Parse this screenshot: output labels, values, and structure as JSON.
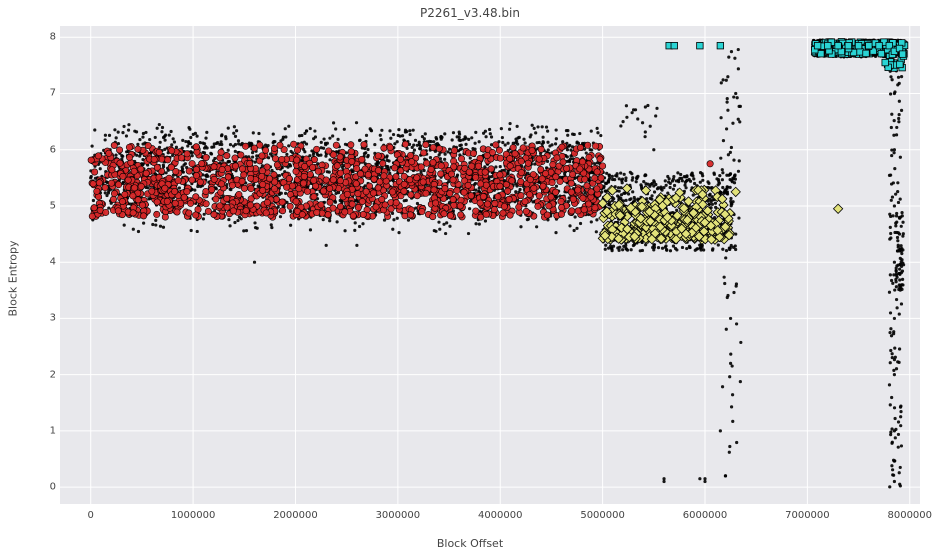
{
  "chart_data": {
    "type": "scatter",
    "title": "P2261_v3.48.bin",
    "xlabel": "Block Offset",
    "ylabel": "Block Entropy",
    "xlim": [
      -300000,
      8100000
    ],
    "ylim": [
      -0.3,
      8.2
    ],
    "xticks": [
      0,
      1000000,
      2000000,
      3000000,
      4000000,
      5000000,
      6000000,
      7000000,
      8000000
    ],
    "yticks": [
      0,
      1,
      2,
      3,
      4,
      5,
      6,
      7,
      8
    ],
    "grid": true,
    "legend": false,
    "series": [
      {
        "name": "black-dots",
        "marker": "circle",
        "size": 3,
        "fill": "#000000",
        "stroke": "#000000",
        "note": "Dense scatter of per-block entropy (raw). Region 0–5,000,000: band ~4.5–6.2; region 5,000,000–6,300,000: band ~3.5–5.5 plus outliers down to ~0 and up to ~7.9; region 7,100,000–7,950,000: mostly near 7.8 with a vertical spread column near ~7,850,000 spanning 0–7.9.",
        "sample_points": [
          {
            "x": 0,
            "y": 5.5
          },
          {
            "x": 200000,
            "y": 5.8
          },
          {
            "x": 400000,
            "y": 5.6
          },
          {
            "x": 600000,
            "y": 5.4
          },
          {
            "x": 800000,
            "y": 5.9
          },
          {
            "x": 1000000,
            "y": 5.7
          },
          {
            "x": 1200000,
            "y": 5.3
          },
          {
            "x": 1400000,
            "y": 5.8
          },
          {
            "x": 1600000,
            "y": 5.6
          },
          {
            "x": 1800000,
            "y": 5.5
          },
          {
            "x": 2000000,
            "y": 5.9
          },
          {
            "x": 2200000,
            "y": 5.4
          },
          {
            "x": 2400000,
            "y": 5.7
          },
          {
            "x": 2600000,
            "y": 5.8
          },
          {
            "x": 2800000,
            "y": 5.5
          },
          {
            "x": 3000000,
            "y": 5.6
          },
          {
            "x": 3500000,
            "y": 5.5
          },
          {
            "x": 4000000,
            "y": 5.7
          },
          {
            "x": 4500000,
            "y": 5.6
          },
          {
            "x": 5000000,
            "y": 5.5
          },
          {
            "x": 1600000,
            "y": 4.0
          },
          {
            "x": 2300000,
            "y": 4.3
          },
          {
            "x": 2600000,
            "y": 4.3
          },
          {
            "x": 5200000,
            "y": 5.0
          },
          {
            "x": 5400000,
            "y": 4.8
          },
          {
            "x": 5600000,
            "y": 4.5
          },
          {
            "x": 5800000,
            "y": 4.9
          },
          {
            "x": 6000000,
            "y": 4.7
          },
          {
            "x": 6200000,
            "y": 5.0
          },
          {
            "x": 5200000,
            "y": 6.5
          },
          {
            "x": 5500000,
            "y": 6.0
          },
          {
            "x": 5600000,
            "y": 0.1
          },
          {
            "x": 6000000,
            "y": 0.1
          },
          {
            "x": 6150000,
            "y": 1.0
          },
          {
            "x": 6200000,
            "y": 0.2
          },
          {
            "x": 6250000,
            "y": 3.0
          },
          {
            "x": 6250000,
            "y": 2.2
          },
          {
            "x": 6300000,
            "y": 7.0
          },
          {
            "x": 6300000,
            "y": 4.5
          },
          {
            "x": 7100000,
            "y": 7.8
          },
          {
            "x": 7300000,
            "y": 7.8
          },
          {
            "x": 7500000,
            "y": 7.8
          },
          {
            "x": 7700000,
            "y": 7.8
          },
          {
            "x": 7800000,
            "y": 7.7
          },
          {
            "x": 7850000,
            "y": 7.0
          },
          {
            "x": 7850000,
            "y": 6.0
          },
          {
            "x": 7850000,
            "y": 5.0
          },
          {
            "x": 7850000,
            "y": 4.0
          },
          {
            "x": 7850000,
            "y": 3.0
          },
          {
            "x": 7850000,
            "y": 2.0
          },
          {
            "x": 7850000,
            "y": 1.0
          },
          {
            "x": 7850000,
            "y": 0.1
          },
          {
            "x": 7900000,
            "y": 4.2
          },
          {
            "x": 7900000,
            "y": 3.8
          },
          {
            "x": 7900000,
            "y": 4.5
          },
          {
            "x": 7920000,
            "y": 7.3
          },
          {
            "x": 7920000,
            "y": 6.7
          }
        ]
      },
      {
        "name": "red-circles",
        "marker": "circle",
        "size": 6,
        "fill": "#d62728",
        "stroke": "#000000",
        "note": "Overlaid red circles on the 0–5,000,000 region band, y roughly 4.8–6.1. A few stragglers near x≈6,000,000, y≈5.7.",
        "band": {
          "xmin": 0,
          "xmax": 5000000,
          "ymin": 4.8,
          "ymax": 6.1
        },
        "extras": [
          {
            "x": 6050000,
            "y": 5.75
          }
        ]
      },
      {
        "name": "cyan-squares",
        "marker": "square",
        "size": 7,
        "fill": "#2ad4d4",
        "stroke": "#000000",
        "note": "High-entropy markers near y≈7.7–7.9 at isolated x≈5,650,000–5,700,000, ~5,950,000, ~6,150,000, then densely across x≈7,100,000–7,950,000.",
        "sample_points": [
          {
            "x": 5650000,
            "y": 7.85
          },
          {
            "x": 5700000,
            "y": 7.85
          },
          {
            "x": 5950000,
            "y": 7.85
          },
          {
            "x": 6150000,
            "y": 7.85
          },
          {
            "x": 7100000,
            "y": 7.85
          },
          {
            "x": 7200000,
            "y": 7.85
          },
          {
            "x": 7300000,
            "y": 7.85
          },
          {
            "x": 7400000,
            "y": 7.85
          },
          {
            "x": 7500000,
            "y": 7.85
          },
          {
            "x": 7600000,
            "y": 7.85
          },
          {
            "x": 7700000,
            "y": 7.85
          },
          {
            "x": 7800000,
            "y": 7.85
          },
          {
            "x": 7850000,
            "y": 7.75
          },
          {
            "x": 7900000,
            "y": 7.8
          },
          {
            "x": 7930000,
            "y": 7.7
          },
          {
            "x": 7760000,
            "y": 7.55
          }
        ]
      },
      {
        "name": "yellow-diamonds",
        "marker": "diamond",
        "size": 7,
        "fill": "#e2e27a",
        "stroke": "#000000",
        "note": "Mid-entropy cluster across x≈5,000,000–6,300,000 with y≈4.4–5.4 plus a few at x≈6,300,000 y≈5.25 and x≈7,300,000 y≈4.95.",
        "band": {
          "xmin": 5000000,
          "xmax": 6250000,
          "ymin": 4.4,
          "ymax": 5.4
        },
        "extras": [
          {
            "x": 6300000,
            "y": 5.25
          },
          {
            "x": 7300000,
            "y": 4.95
          }
        ]
      }
    ]
  }
}
